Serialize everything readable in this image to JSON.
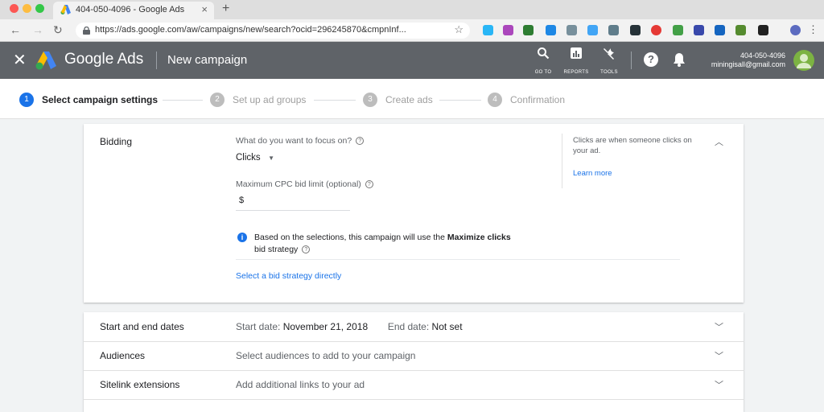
{
  "browser": {
    "tab_title": "404-050-4096 - Google Ads",
    "tab_close": "×",
    "new_tab": "+",
    "url": "https://ads.google.com/aw/campaigns/new/search?ocid=296245870&cmpnInf...",
    "colors": {
      "close": "#fc5753",
      "minimize": "#fdbc40",
      "maximize": "#33c748"
    }
  },
  "header": {
    "close_label": "✕",
    "brand": "Google Ads",
    "page_title": "New campaign",
    "tools": [
      {
        "label": "GO TO",
        "icon": "search-icon"
      },
      {
        "label": "REPORTS",
        "icon": "reports-icon"
      },
      {
        "label": "TOOLS",
        "icon": "wrench-icon"
      }
    ],
    "account_id": "404-050-4096",
    "account_email": "miningisall@gmail.com"
  },
  "stepper": {
    "steps": [
      {
        "num": "1",
        "label": "Select campaign settings"
      },
      {
        "num": "2",
        "label": "Set up ad groups"
      },
      {
        "num": "3",
        "label": "Create ads"
      },
      {
        "num": "4",
        "label": "Confirmation"
      }
    ]
  },
  "bidding": {
    "section_label": "Bidding",
    "focus_question": "What do you want to focus on?",
    "focus_value": "Clicks",
    "max_cpc_label": "Maximum CPC bid limit (optional)",
    "currency": "$",
    "info_text_prefix": "Based on the selections, this campaign will use the ",
    "info_text_bold": "Maximize clicks",
    "info_text_suffix": "bid strategy",
    "link": "Select a bid strategy directly",
    "side_help": "Clicks are when someone clicks on your ad.",
    "learn_more": "Learn more"
  },
  "rows": [
    {
      "label": "Start and end dates",
      "start_label": "Start date:",
      "start_value": "November 21, 2018",
      "end_label": "End date:",
      "end_value": "Not set"
    },
    {
      "label": "Audiences",
      "value": "Select audiences to add to your campaign"
    },
    {
      "label": "Sitelink extensions",
      "value": "Add additional links to your ad"
    }
  ]
}
